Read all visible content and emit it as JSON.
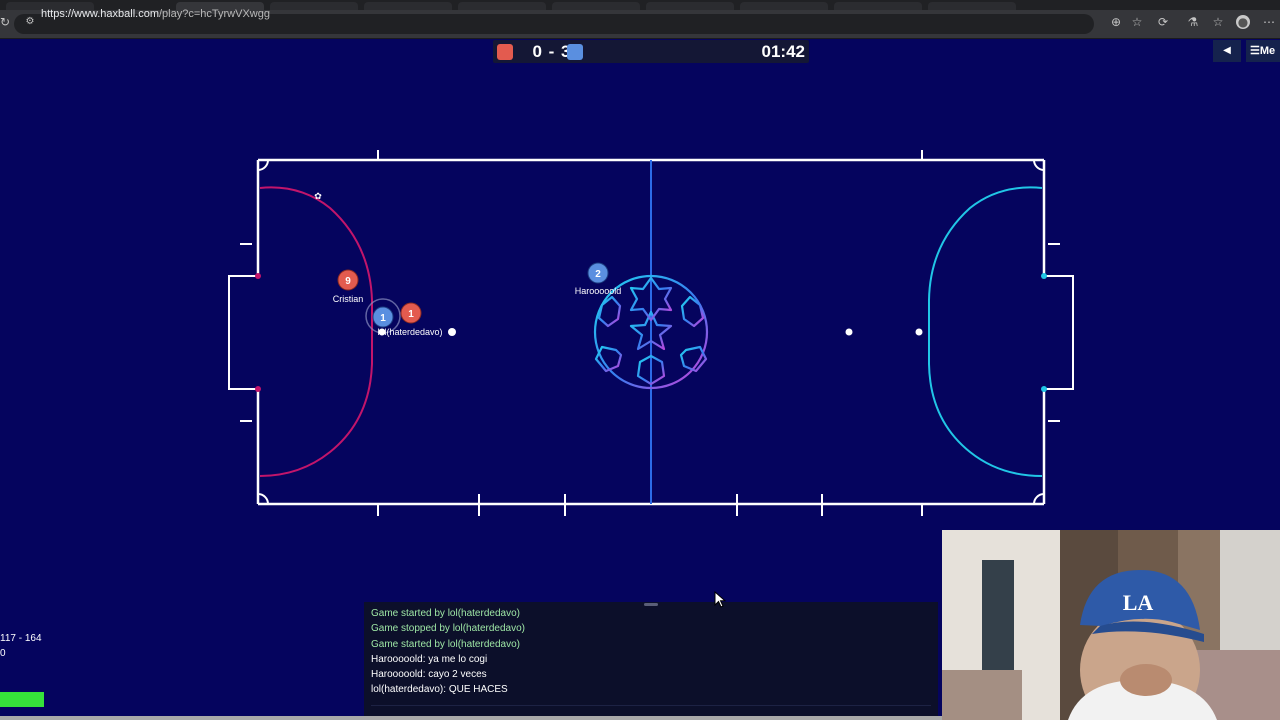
{
  "browser": {
    "url_host": "https://www.haxball.com",
    "url_path": "/play?c=hcTyrwVXwgg"
  },
  "hud": {
    "score": "0 - 3",
    "red_score": 0,
    "blue_score": 3,
    "timer": "01:42",
    "menu_label": "Me",
    "red_color": "#e35b4f",
    "blue_color": "#5a8fe0"
  },
  "field": {
    "background": "#05045e",
    "line_color": "#ffffff",
    "red_zone_color": "#c2156b",
    "blue_zone_color": "#21c6e6",
    "midline_color": "#2c6be8",
    "players": [
      {
        "team": "red",
        "number": "9",
        "name": "Cristian"
      },
      {
        "team": "red",
        "number": "1",
        "name": ""
      },
      {
        "team": "blue",
        "number": "1",
        "name": "lol(haterdedavo)"
      },
      {
        "team": "blue",
        "number": "2",
        "name": "Harooooold"
      }
    ],
    "center_logo_icon": "champions-star-ball-icon"
  },
  "chat": {
    "messages": [
      {
        "text": "Game started by lol(haterdedavo)",
        "type": "system"
      },
      {
        "text": "Game stopped by lol(haterdedavo)",
        "type": "system"
      },
      {
        "text": "Game started by lol(haterdedavo)",
        "type": "system"
      },
      {
        "text": "Harooooold: ya me lo cogi",
        "type": "user"
      },
      {
        "text": "Harooooold: cayo 2 veces",
        "type": "user"
      },
      {
        "text": "lol(haterdedavo): QUE HACES",
        "type": "user"
      }
    ]
  },
  "stats": {
    "line1": "117 - 164",
    "line2": "0"
  }
}
